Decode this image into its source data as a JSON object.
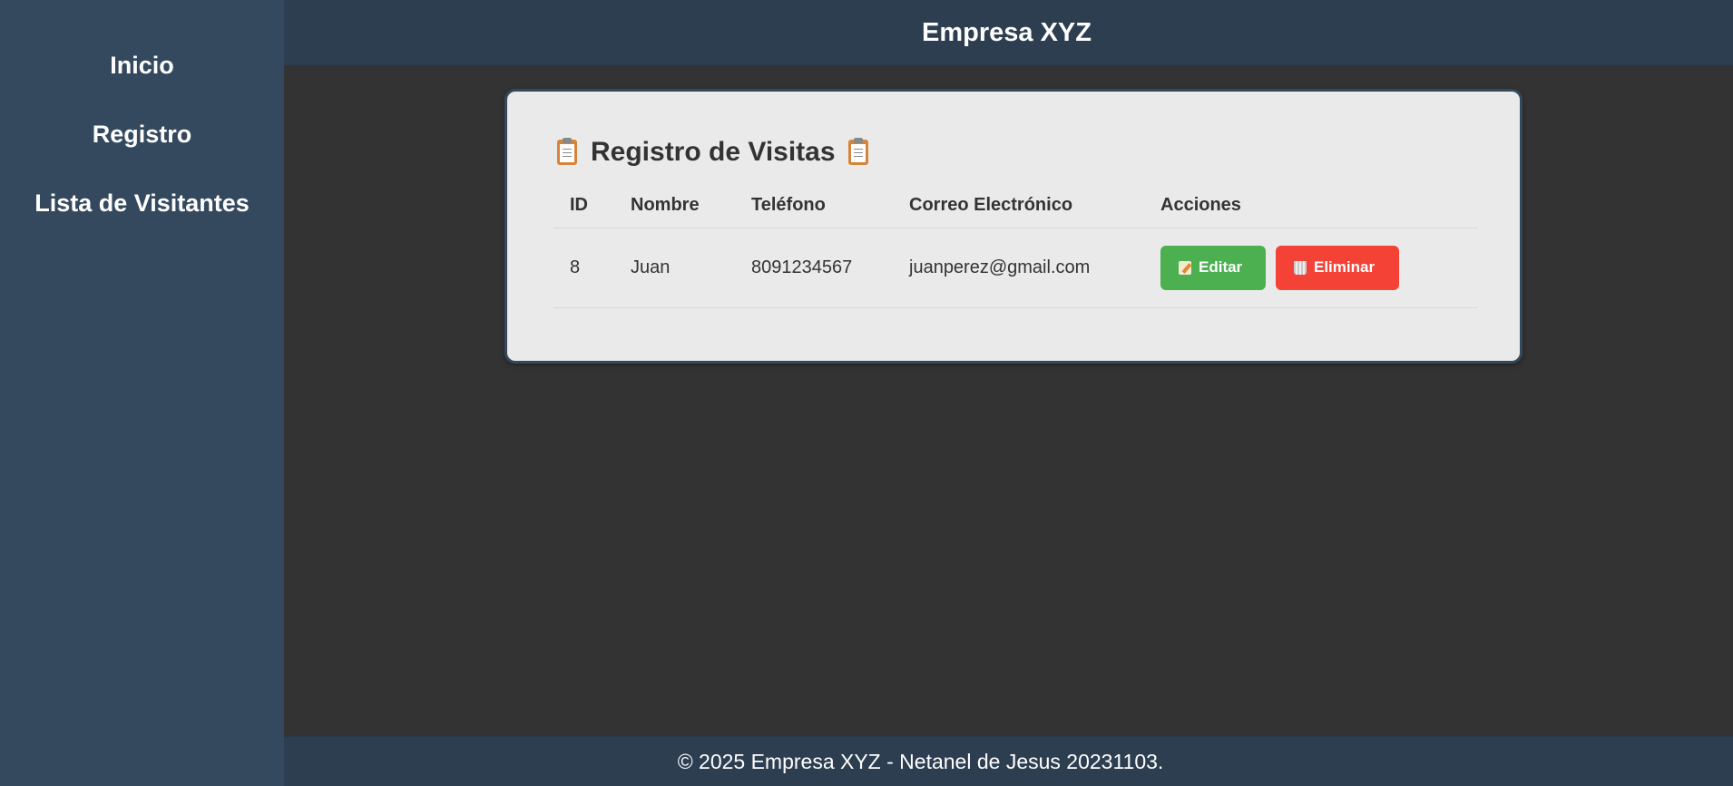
{
  "header": {
    "title": "Empresa XYZ"
  },
  "sidebar": {
    "items": [
      {
        "label": "Inicio"
      },
      {
        "label": "Registro"
      },
      {
        "label": "Lista de Visitantes"
      }
    ]
  },
  "card": {
    "title": "Registro de Visitas",
    "title_icon": "clipboard-icon"
  },
  "table": {
    "headers": [
      "ID",
      "Nombre",
      "Teléfono",
      "Correo Electrónico",
      "Acciones"
    ],
    "rows": [
      {
        "id": "8",
        "nombre": "Juan",
        "telefono": "8091234567",
        "correo": "juanperez@gmail.com",
        "actions": {
          "edit_label": "Editar",
          "edit_icon": "memo-icon",
          "delete_label": "Eliminar",
          "delete_icon": "wastebasket-icon"
        }
      }
    ]
  },
  "footer": {
    "text": "© 2025 Empresa XYZ - Netanel de Jesus 20231103."
  },
  "colors": {
    "sidebar_bg": "#34495e",
    "header_bg": "#2c3e50",
    "page_bg": "#333333",
    "card_bg": "#eaeaea",
    "edit_button": "#4caf50",
    "delete_button": "#f44336"
  }
}
